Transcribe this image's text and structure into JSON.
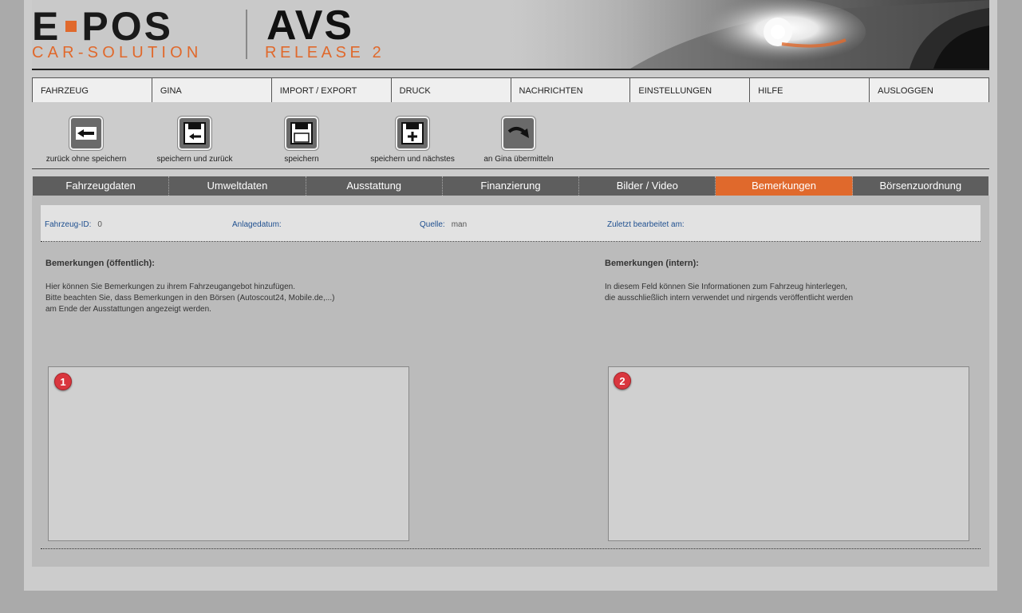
{
  "logo": {
    "left_text_a": "E",
    "left_text_b": "POS",
    "left_sub": "CAR-SOLUTION",
    "right_text": "AVS",
    "right_sub": "RELEASE 2",
    "accent_color": "#e0692c"
  },
  "nav": {
    "items": [
      {
        "label": "FAHRZEUG"
      },
      {
        "label": "GINA"
      },
      {
        "label": "IMPORT / EXPORT"
      },
      {
        "label": "DRUCK"
      },
      {
        "label": "NACHRICHTEN"
      },
      {
        "label": "EINSTELLUNGEN"
      },
      {
        "label": "HILFE"
      },
      {
        "label": "AUSLOGGEN"
      }
    ]
  },
  "toolbar": {
    "back_no_save": "zurück ohne speichern",
    "save_and_back": "speichern und zurück",
    "save": "speichern",
    "save_and_next": "speichern und nächstes",
    "send_gina": "an Gina übermitteln"
  },
  "tabs": {
    "items": [
      {
        "label": "Fahrzeugdaten"
      },
      {
        "label": "Umweltdaten"
      },
      {
        "label": "Ausstattung"
      },
      {
        "label": "Finanzierung"
      },
      {
        "label": "Bilder / Video"
      },
      {
        "label": "Bemerkungen"
      },
      {
        "label": "Börsenzuordnung"
      }
    ],
    "active": "Bemerkungen"
  },
  "info": {
    "vehicle_id_label": "Fahrzeug-ID:",
    "vehicle_id_value": "0",
    "created_label": "Anlagedatum:",
    "created_value": "",
    "source_label": "Quelle:",
    "source_value": "man",
    "last_edited_label": "Zuletzt bearbeitet am:",
    "last_edited_value": ""
  },
  "public_remarks": {
    "title": "Bemerkungen (öffentlich):",
    "line1": "Hier können Sie Bemerkungen zu ihrem Fahrzeugangebot hinzufügen.",
    "line2": "Bitte beachten Sie, dass Bemerkungen in den Börsen (Autoscout24, Mobile.de,...)",
    "line3": "am Ende der Ausstattungen angezeigt werden.",
    "badge": "1",
    "value": ""
  },
  "internal_remarks": {
    "title": "Bemerkungen (intern):",
    "line1": "In diesem Feld können Sie Informationen zum Fahrzeug hinterlegen,",
    "line2": "die ausschließlich intern verwendet und nirgends veröffentlicht werden",
    "badge": "2",
    "value": ""
  }
}
